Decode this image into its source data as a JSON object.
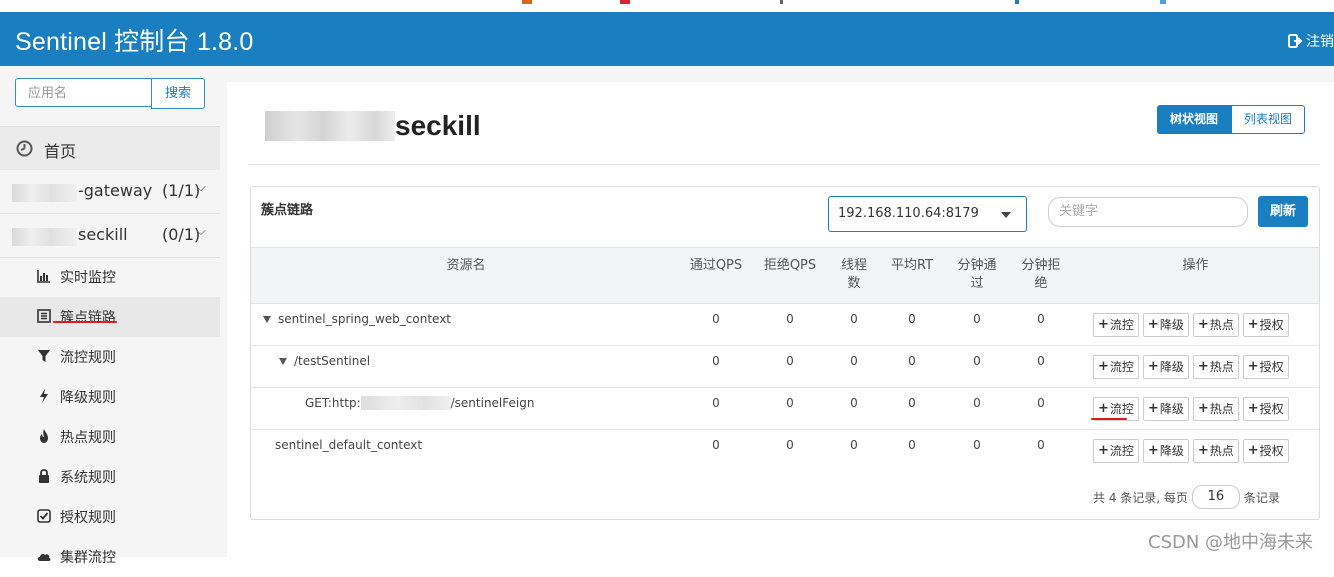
{
  "header": {
    "title": "Sentinel 控制台 1.8.0",
    "logout_label": "注销",
    "background": "#1a7fc1"
  },
  "sidebar": {
    "search_placeholder": "应用名",
    "search_button": "搜索",
    "home_label": "首页",
    "apps": [
      {
        "name": "-gateway",
        "count": "(1/1)"
      },
      {
        "name": "seckill",
        "count": "(0/1)"
      }
    ],
    "items": [
      {
        "label": "实时监控",
        "icon": "bar-chart-icon"
      },
      {
        "label": "簇点链路",
        "icon": "list-icon",
        "active": true
      },
      {
        "label": "流控规则",
        "icon": "filter-icon"
      },
      {
        "label": "降级规则",
        "icon": "bolt-icon"
      },
      {
        "label": "热点规则",
        "icon": "fire-icon"
      },
      {
        "label": "系统规则",
        "icon": "lock-icon"
      },
      {
        "label": "授权规则",
        "icon": "check-square-icon"
      },
      {
        "label": "集群流控",
        "icon": "cloud-icon"
      }
    ]
  },
  "page": {
    "title_suffix": "seckill",
    "view_tree": "树状视图",
    "view_list": "列表视图"
  },
  "panel": {
    "title": "簇点链路",
    "machine": "192.168.110.64:8179",
    "keyword_placeholder": "关键字",
    "refresh": "刷新",
    "columns": {
      "resource": "资源名",
      "pass_qps": "通过QPS",
      "block_qps": "拒绝QPS",
      "threads_1": "线程",
      "threads_2": "数",
      "avg_rt": "平均RT",
      "min_pass_1": "分钟通",
      "min_pass_2": "过",
      "min_block_1": "分钟拒",
      "min_block_2": "绝",
      "ops": "操作"
    },
    "rows": [
      {
        "name": "sentinel_spring_web_context",
        "pass": "0",
        "block": "0",
        "threads": "0",
        "rt": "0",
        "min_pass": "0",
        "min_block": "0"
      },
      {
        "name": "/testSentinel",
        "pass": "0",
        "block": "0",
        "threads": "0",
        "rt": "0",
        "min_pass": "0",
        "min_block": "0"
      },
      {
        "name_prefix": "GET:http:",
        "name_suffix": "/sentinelFeign",
        "pass": "0",
        "block": "0",
        "threads": "0",
        "rt": "0",
        "min_pass": "0",
        "min_block": "0"
      },
      {
        "name": "sentinel_default_context",
        "pass": "0",
        "block": "0",
        "threads": "0",
        "rt": "0",
        "min_pass": "0",
        "min_block": "0"
      }
    ],
    "op_labels": {
      "flow": "流控",
      "degrade": "降级",
      "hot": "热点",
      "auth": "授权"
    },
    "pager": {
      "prefix": "共 4 条记录, 每页",
      "page_size": "16",
      "suffix": "条记录"
    }
  },
  "watermark": "CSDN @地中海未来"
}
